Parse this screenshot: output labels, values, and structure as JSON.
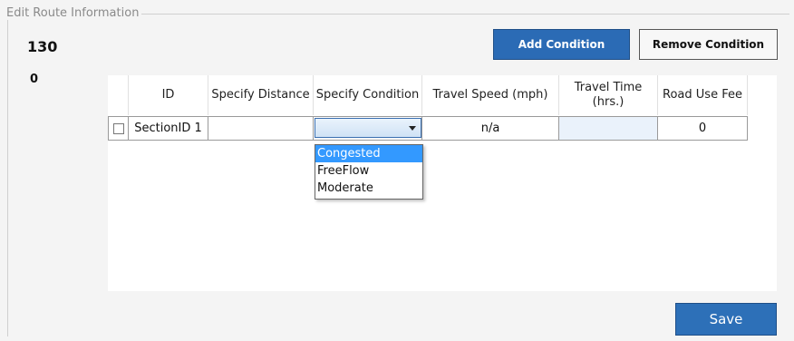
{
  "panel": {
    "legend": "Edit Route Information",
    "count_main": "130",
    "count_sub": "0"
  },
  "buttons": {
    "add": "Add Condition",
    "remove": "Remove Condition",
    "save": "Save"
  },
  "grid": {
    "headers": [
      "ID",
      "Specify Distance",
      "Specify Condition",
      "Travel Speed (mph)",
      "Travel Time (hrs.)",
      "Road Use Fee"
    ],
    "rows": [
      {
        "id": "SectionID 1",
        "distance": "",
        "condition": "",
        "speed": "n/a",
        "time": "",
        "fee": "0"
      }
    ]
  },
  "dropdown": {
    "options": [
      "Congested",
      "FreeFlow",
      "Moderate"
    ],
    "highlighted": "Congested"
  },
  "colors": {
    "primary_button": "#2b6bb5",
    "highlight": "#3399ff",
    "travel_time_cell": "#eaf2fb"
  }
}
